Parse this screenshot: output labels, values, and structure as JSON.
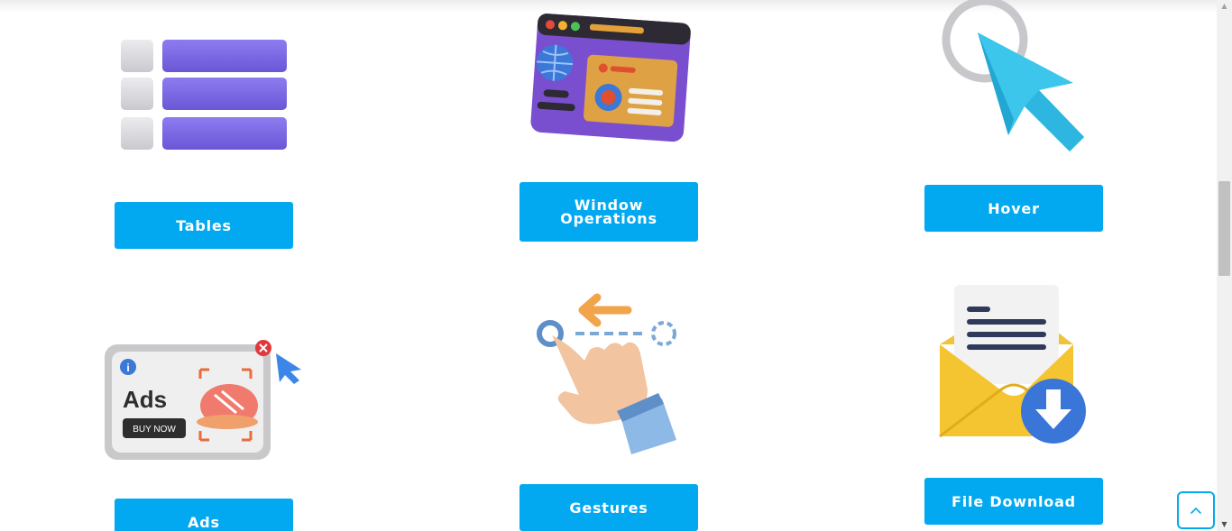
{
  "cards": [
    {
      "label": "Tables",
      "icon": "table-list-icon"
    },
    {
      "label_line1": "Window",
      "label_line2": "Operations",
      "icon": "browser-window-icon"
    },
    {
      "label": "Hover",
      "icon": "mouse-pointer-icon"
    },
    {
      "label": "Ads",
      "icon": "ad-banner-icon",
      "illus_text": "Ads",
      "illus_button": "BUY NOW",
      "illus_info": "i"
    },
    {
      "label": "Gestures",
      "icon": "swipe-hand-icon"
    },
    {
      "label": "File Download",
      "icon": "envelope-download-icon"
    }
  ],
  "scroll_top": {
    "icon": "chevron-up-icon"
  },
  "colors": {
    "accent": "#03a9f0",
    "button_text": "#ffffff",
    "table_bar": "#7b68e0",
    "pointer": "#3cc6ec"
  }
}
